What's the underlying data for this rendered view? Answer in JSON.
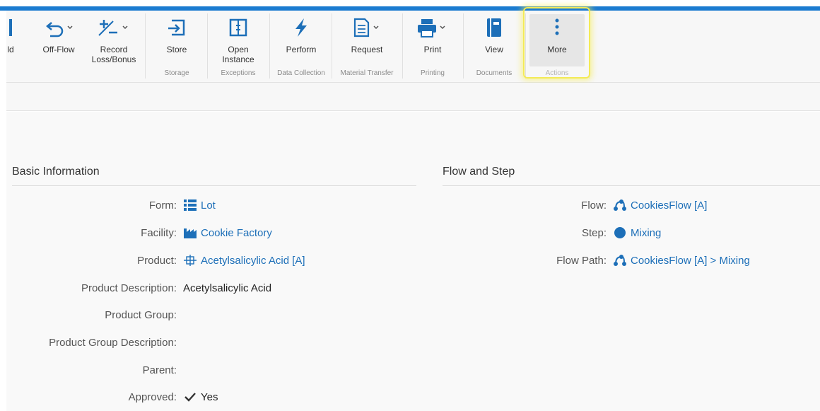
{
  "ribbon": {
    "buttons": [
      {
        "label": "ld",
        "icon": "bar-icon"
      },
      {
        "label": "Off-Flow",
        "icon": "undo-arrow-icon"
      },
      {
        "label": "Record\nLoss/Bonus",
        "icon": "plus-minus-icon"
      },
      {
        "label": "Store",
        "icon": "store-into-icon"
      },
      {
        "label": "Open\nInstance",
        "icon": "open-instance-icon"
      },
      {
        "label": "Perform",
        "icon": "lightning-icon"
      },
      {
        "label": "Request",
        "icon": "document-icon"
      },
      {
        "label": "Print",
        "icon": "printer-icon"
      },
      {
        "label": "View",
        "icon": "book-icon"
      },
      {
        "label": "More",
        "icon": "vertical-dots-icon"
      }
    ],
    "groups": [
      "Storage",
      "Exceptions",
      "Data Collection",
      "Material Transfer",
      "Printing",
      "Documents",
      "Actions"
    ]
  },
  "basic_info": {
    "title": "Basic Information",
    "rows": [
      {
        "key": "Form:",
        "value": "Lot",
        "icon": "list-icon",
        "link": true
      },
      {
        "key": "Facility:",
        "value": "Cookie Factory",
        "icon": "factory-icon",
        "link": true
      },
      {
        "key": "Product:",
        "value": "Acetylsalicylic Acid [A]",
        "icon": "product-icon",
        "link": true
      },
      {
        "key": "Product Description:",
        "value": "Acetylsalicylic Acid",
        "link": false
      },
      {
        "key": "Product Group:",
        "value": "",
        "link": false
      },
      {
        "key": "Product Group Description:",
        "value": "",
        "link": false
      },
      {
        "key": "Parent:",
        "value": "",
        "link": false
      },
      {
        "key": "Approved:",
        "value": "Yes",
        "icon": "check-icon",
        "link": false
      }
    ]
  },
  "flow_step": {
    "title": "Flow and Step",
    "rows": [
      {
        "key": "Flow:",
        "value": "CookiesFlow [A]",
        "icon": "flow-icon",
        "link": true
      },
      {
        "key": "Step:",
        "value": "Mixing",
        "icon": "step-dot-icon",
        "link": true
      },
      {
        "key": "Flow Path:",
        "value": "CookiesFlow [A] > Mixing",
        "icon": "flow-icon",
        "link": true
      }
    ]
  },
  "colors": {
    "accent": "#1b7bd0",
    "link": "#1d6fb8",
    "highlight": "#f3ea56"
  }
}
